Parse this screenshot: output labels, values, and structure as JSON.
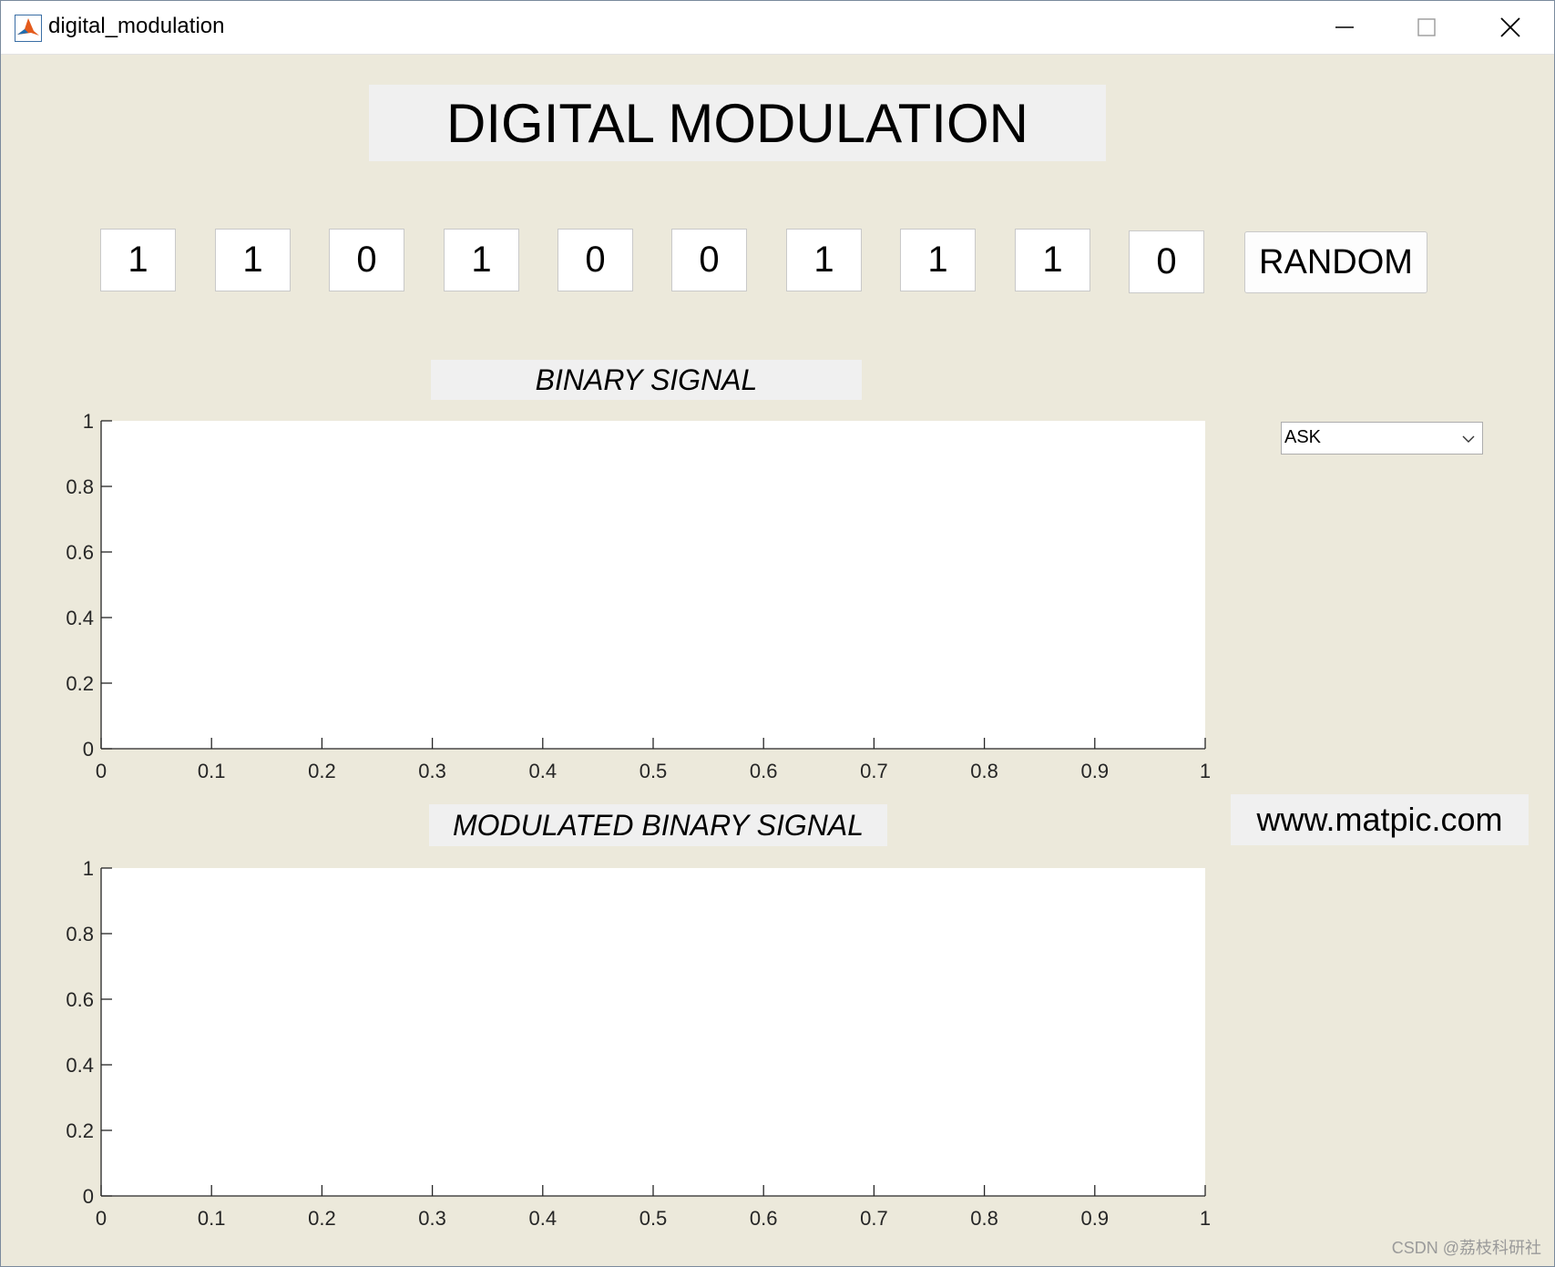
{
  "window": {
    "title": "digital_modulation"
  },
  "heading": "DIGITAL MODULATION",
  "bits": [
    "1",
    "1",
    "0",
    "1",
    "0",
    "0",
    "1",
    "1",
    "1",
    "0"
  ],
  "random_button": "RANDOM",
  "binary_label": "BINARY SIGNAL",
  "modulated_label": "MODULATED BINARY SIGNAL",
  "modulation_select": {
    "value": "ASK"
  },
  "url": "www.matpic.com",
  "watermark": "CSDN @荔枝科研社",
  "chart_data": [
    {
      "type": "line",
      "title": "",
      "series": [],
      "xlim": [
        0,
        1
      ],
      "ylim": [
        0,
        1
      ],
      "xticks": [
        "0",
        "0.1",
        "0.2",
        "0.3",
        "0.4",
        "0.5",
        "0.6",
        "0.7",
        "0.8",
        "0.9",
        "1"
      ],
      "yticks": [
        "0",
        "0.2",
        "0.4",
        "0.6",
        "0.8",
        "1"
      ]
    },
    {
      "type": "line",
      "title": "",
      "series": [],
      "xlim": [
        0,
        1
      ],
      "ylim": [
        0,
        1
      ],
      "xticks": [
        "0",
        "0.1",
        "0.2",
        "0.3",
        "0.4",
        "0.5",
        "0.6",
        "0.7",
        "0.8",
        "0.9",
        "1"
      ],
      "yticks": [
        "0",
        "0.2",
        "0.4",
        "0.6",
        "0.8",
        "1"
      ]
    }
  ]
}
